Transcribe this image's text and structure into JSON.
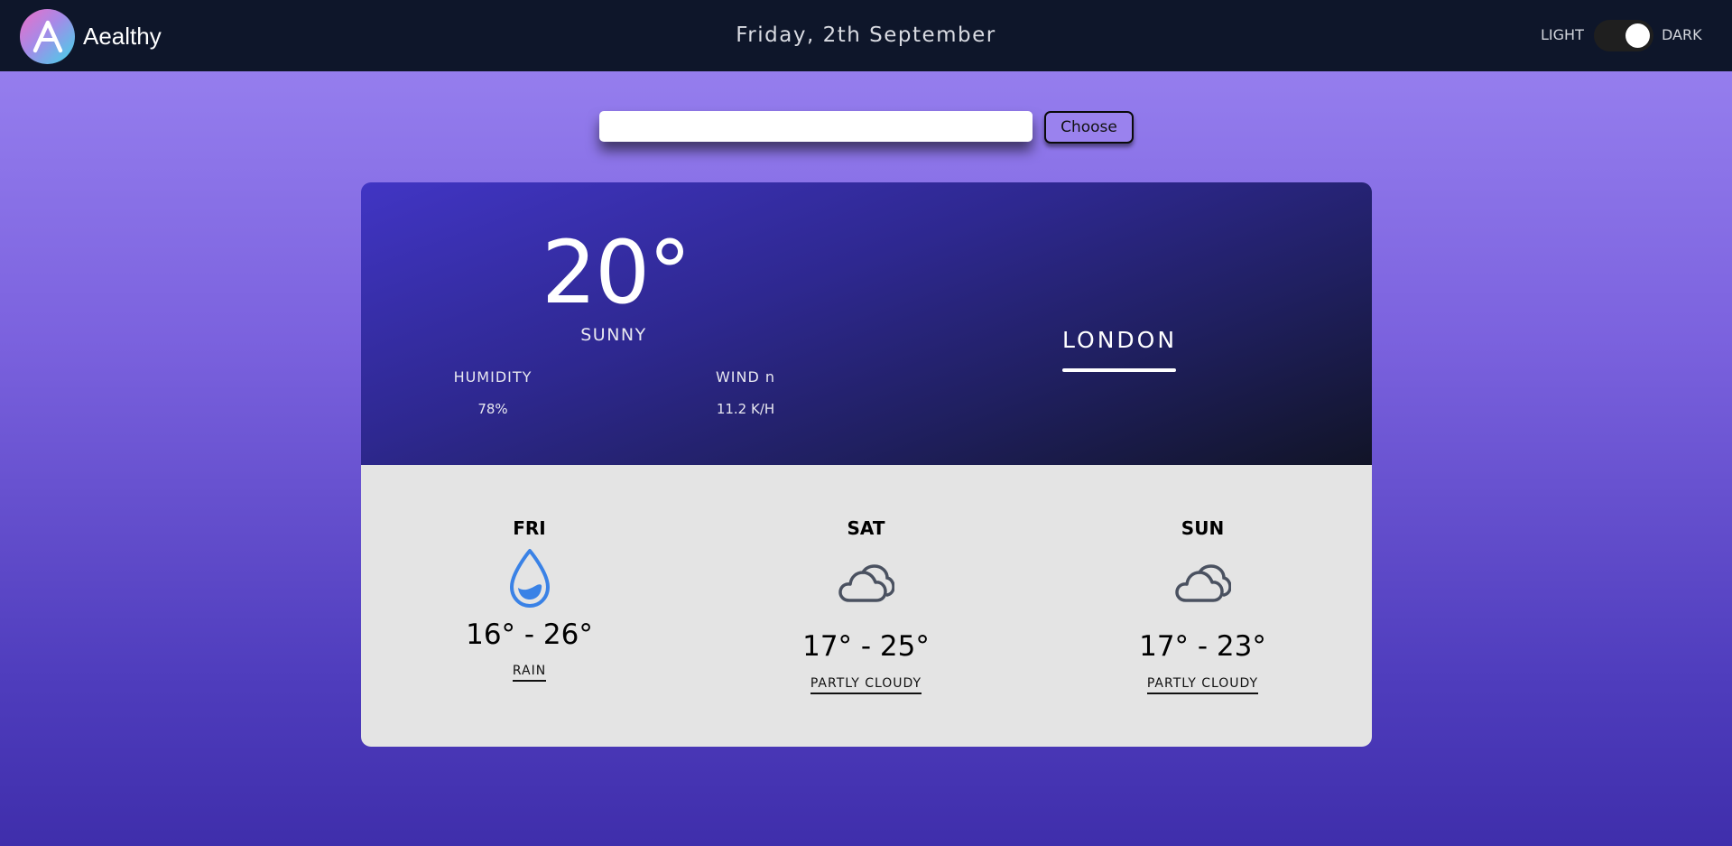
{
  "header": {
    "brand": "Aealthy",
    "date": "Friday, 2th September",
    "theme_light": "LIGHT",
    "theme_dark": "DARK"
  },
  "search": {
    "value": "",
    "placeholder": "",
    "button_label": "Choose"
  },
  "current": {
    "temperature": "20°",
    "condition": "SUNNY",
    "humidity_label": "HUMIDITY",
    "humidity_value": "78%",
    "wind_label": "WIND n",
    "wind_value": "11.2 K/H",
    "city": "LONDON"
  },
  "forecast": [
    {
      "day": "FRI",
      "range": "16° - 26°",
      "condition": "RAIN",
      "icon": "raindrop-icon"
    },
    {
      "day": "SAT",
      "range": "17° - 25°",
      "condition": "PARTLY CLOUDY",
      "icon": "cloud-icon"
    },
    {
      "day": "SUN",
      "range": "17° - 23°",
      "condition": "PARTLY CLOUDY",
      "icon": "cloud-icon"
    }
  ],
  "colors": {
    "header_bg": "#0e162a",
    "card_top_start": "#4135c4",
    "card_top_end": "#111427",
    "card_bottom": "#e4e4e4",
    "raindrop": "#3a82e6",
    "cloud": "#4a5160"
  }
}
